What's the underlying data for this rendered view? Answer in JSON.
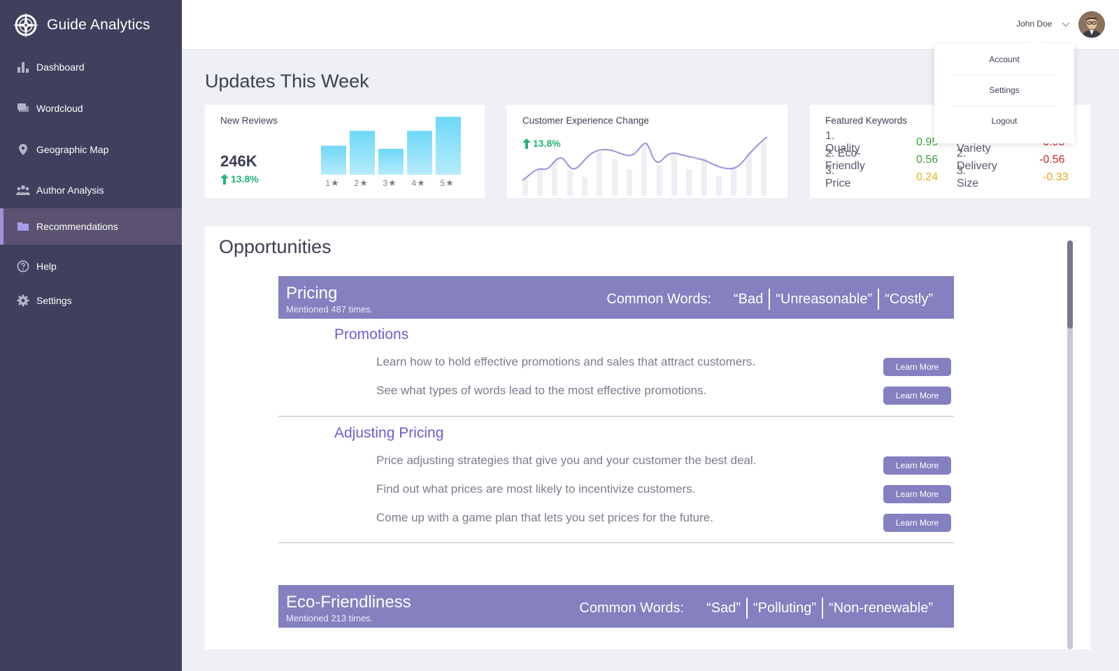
{
  "brand": {
    "name": "Guide Analytics",
    "logo_icon": "compass-icon"
  },
  "sidebar": {
    "items": [
      {
        "label": "Dashboard",
        "icon": "bar-chart-icon"
      },
      {
        "label": "Wordcloud",
        "icon": "comment-icon"
      },
      {
        "label": "Geographic Map",
        "icon": "map-pin-icon"
      },
      {
        "label": "Author Analysis",
        "icon": "users-icon"
      },
      {
        "label": "Recommendations",
        "icon": "folder-icon",
        "active": true
      },
      {
        "label": "Help",
        "icon": "question-icon"
      },
      {
        "label": "Settings",
        "icon": "gear-icon"
      }
    ]
  },
  "header": {
    "user_name": "John Doe",
    "menu": {
      "account": "Account",
      "settings": "Settings",
      "logout": "Logout"
    }
  },
  "updates": {
    "title": "Updates This Week",
    "new_reviews": {
      "title": "New Reviews",
      "value": "246K",
      "change": "13.8%",
      "chart_data": {
        "type": "bar",
        "categories": [
          "1",
          "2",
          "3",
          "4",
          "5"
        ],
        "values": [
          39,
          59,
          35,
          59,
          78
        ]
      }
    },
    "customer_experience": {
      "title": "Customer Experience Change",
      "change": "13.8%"
    },
    "featured_keywords": {
      "title": "Featured Keywords",
      "positive": [
        {
          "name": "1. Quality",
          "value": "0.95"
        },
        {
          "name": "2. Eco-Friendly",
          "value": "0.56"
        },
        {
          "name": "3. Price",
          "value": "0.24"
        }
      ],
      "negative": [
        {
          "name": "1. Variety",
          "value": "-0.95"
        },
        {
          "name": "2. Delivery",
          "value": "-0.56"
        },
        {
          "name": "3. Size",
          "value": "-0.33"
        }
      ],
      "colors": {
        "green": "#3aa23a",
        "yellow": "#e2b21c",
        "red": "#d0262b",
        "orange": "#e2a91c"
      }
    }
  },
  "opportunities": {
    "title": "Opportunities",
    "common_words_label": "Common Words:",
    "learn_more": "Learn More",
    "pricing": {
      "title": "Pricing",
      "mentions": "Mentioned 487 times.",
      "words": [
        "“Bad",
        "“Unreasonable”",
        "“Costly”"
      ],
      "promotions": {
        "title": "Promotions",
        "items": [
          "Learn how to hold effective promotions and sales that attract customers.",
          "See what types of words lead to the most effective promotions."
        ]
      },
      "adjusting": {
        "title": "Adjusting Pricing",
        "items": [
          "Price adjusting strategies that give you and your customer the best deal.",
          "Find out what prices are most likely to incentivize customers.",
          "Come up with a game plan that lets you set prices for the future."
        ]
      }
    },
    "eco": {
      "title": "Eco-Friendliness",
      "mentions": "Mentioned 213 times.",
      "words": [
        "“Sad”",
        "“Polluting”",
        "“Non-renewable”"
      ]
    }
  }
}
